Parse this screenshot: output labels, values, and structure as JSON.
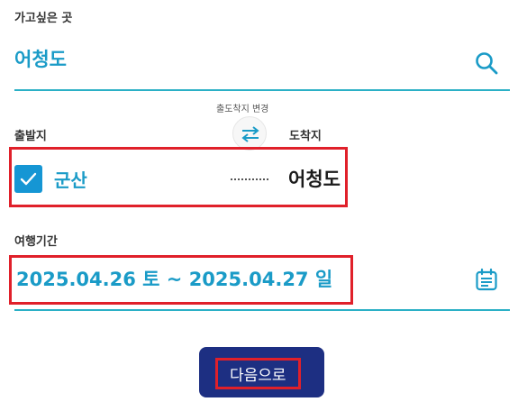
{
  "destination": {
    "label": "가고싶은 곳",
    "value": "어청도",
    "search_icon": "search-icon"
  },
  "swap": {
    "label": "출도착지 변경",
    "icon": "swap-arrows-icon"
  },
  "route": {
    "origin_label": "출발지",
    "origin_value": "군산",
    "origin_checked": true,
    "arrival_label": "도착지",
    "arrival_value": "어청도"
  },
  "period": {
    "label": "여행기간",
    "value": "2025.04.26 토 ~ 2025.04.27 일",
    "calendar_icon": "calendar-icon"
  },
  "actions": {
    "next_label": "다음으로"
  },
  "colors": {
    "accent": "#1a9bc7",
    "line": "#2bb0c6",
    "checkbox": "#1596d4",
    "button_bg": "#1d2f82",
    "highlight": "#e0202a"
  }
}
